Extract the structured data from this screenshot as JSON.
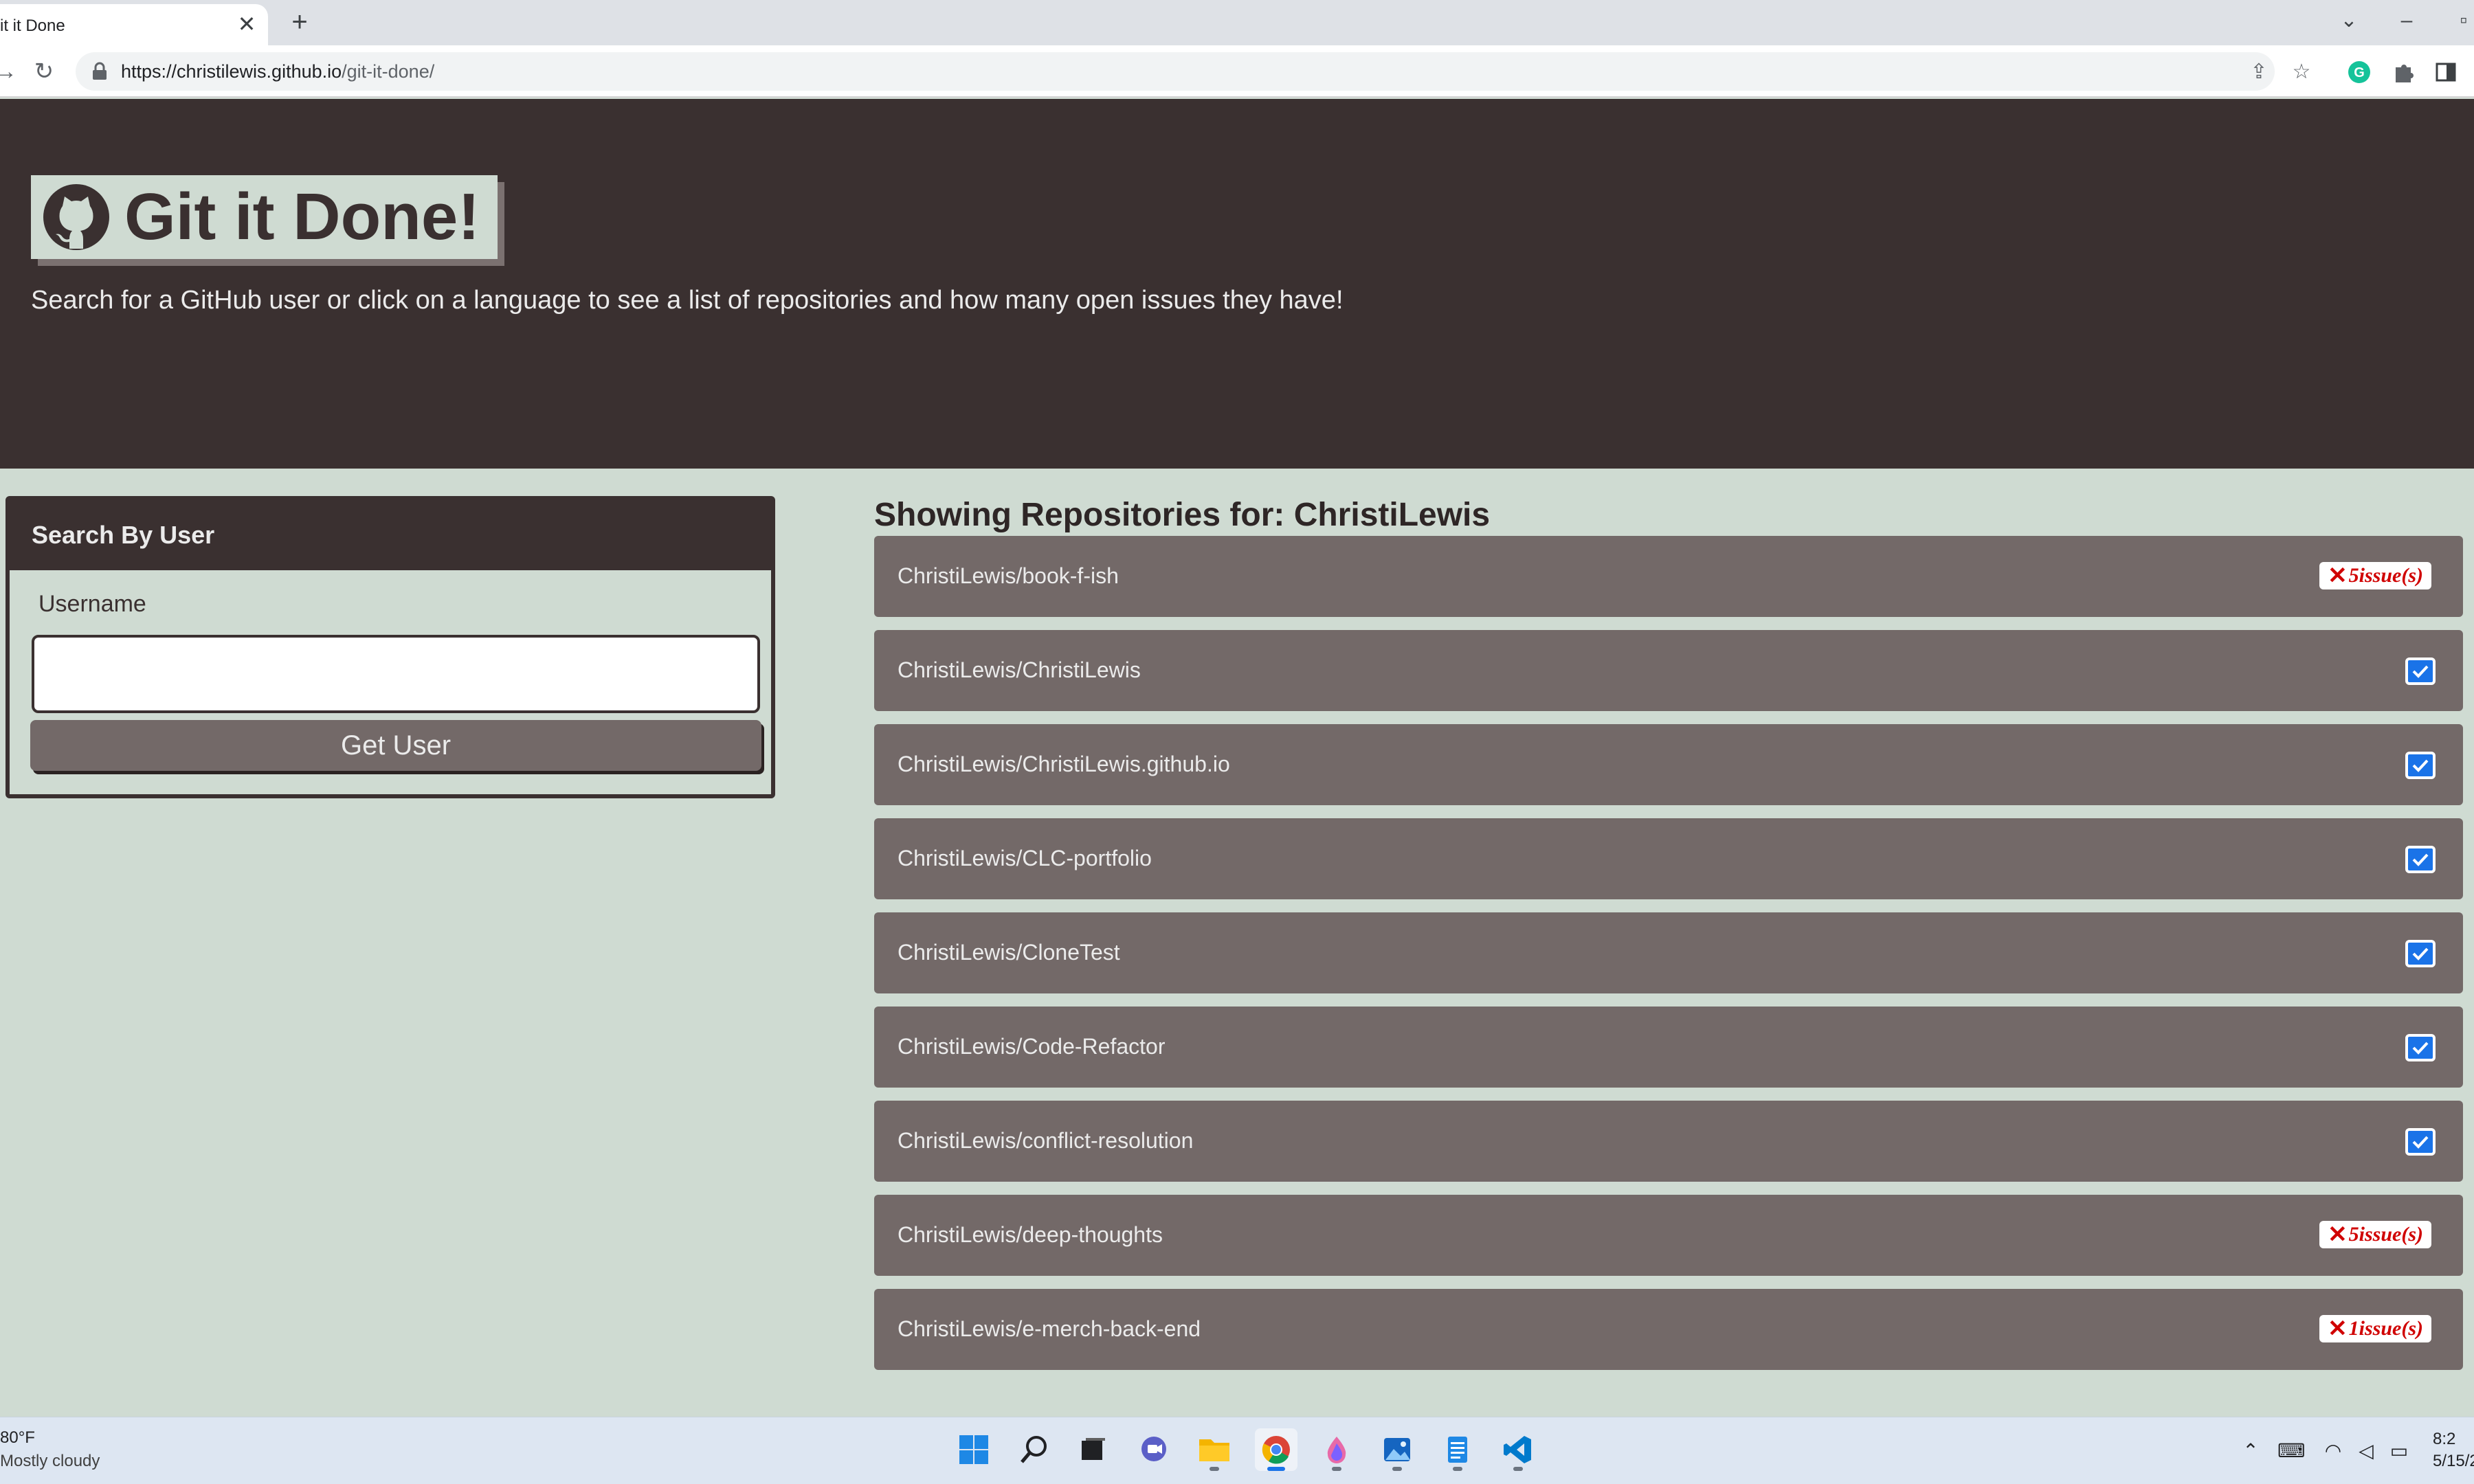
{
  "browser": {
    "tab_title": "it it Done",
    "tab_close": "✕",
    "new_tab": "+",
    "url_host": "https://christilewis.github.io",
    "url_path": "/git-it-done/"
  },
  "header": {
    "logo_text": "Git it Done!",
    "subtitle": "Search for a GitHub user or click on a language to see a list of repositories and how many open issues they have!"
  },
  "search": {
    "title": "Search By User",
    "label": "Username",
    "value": "",
    "button": "Get User"
  },
  "repos": {
    "heading": "Showing Repositories for: ChristiLewis",
    "items": [
      {
        "name": "ChristiLewis/book-f-ish",
        "status": "issues",
        "issues": "5issue(s)"
      },
      {
        "name": "ChristiLewis/ChristiLewis",
        "status": "ok"
      },
      {
        "name": "ChristiLewis/ChristiLewis.github.io",
        "status": "ok"
      },
      {
        "name": "ChristiLewis/CLC-portfolio",
        "status": "ok"
      },
      {
        "name": "ChristiLewis/CloneTest",
        "status": "ok"
      },
      {
        "name": "ChristiLewis/Code-Refactor",
        "status": "ok"
      },
      {
        "name": "ChristiLewis/conflict-resolution",
        "status": "ok"
      },
      {
        "name": "ChristiLewis/deep-thoughts",
        "status": "issues",
        "issues": "5issue(s)"
      },
      {
        "name": "ChristiLewis/e-merch-back-end",
        "status": "issues",
        "issues": "1issue(s)"
      }
    ],
    "issue_mark": "✕"
  },
  "taskbar": {
    "weather_temp": "80°F",
    "weather_desc": "Mostly cloudy",
    "time": "8:2",
    "date": "5/15/2"
  },
  "colors": {
    "header_bg": "#3a3030",
    "page_bg": "#cfdbd2",
    "repo_bg": "#736968",
    "issue_red": "#d00000",
    "check_blue": "#1a73e8"
  }
}
